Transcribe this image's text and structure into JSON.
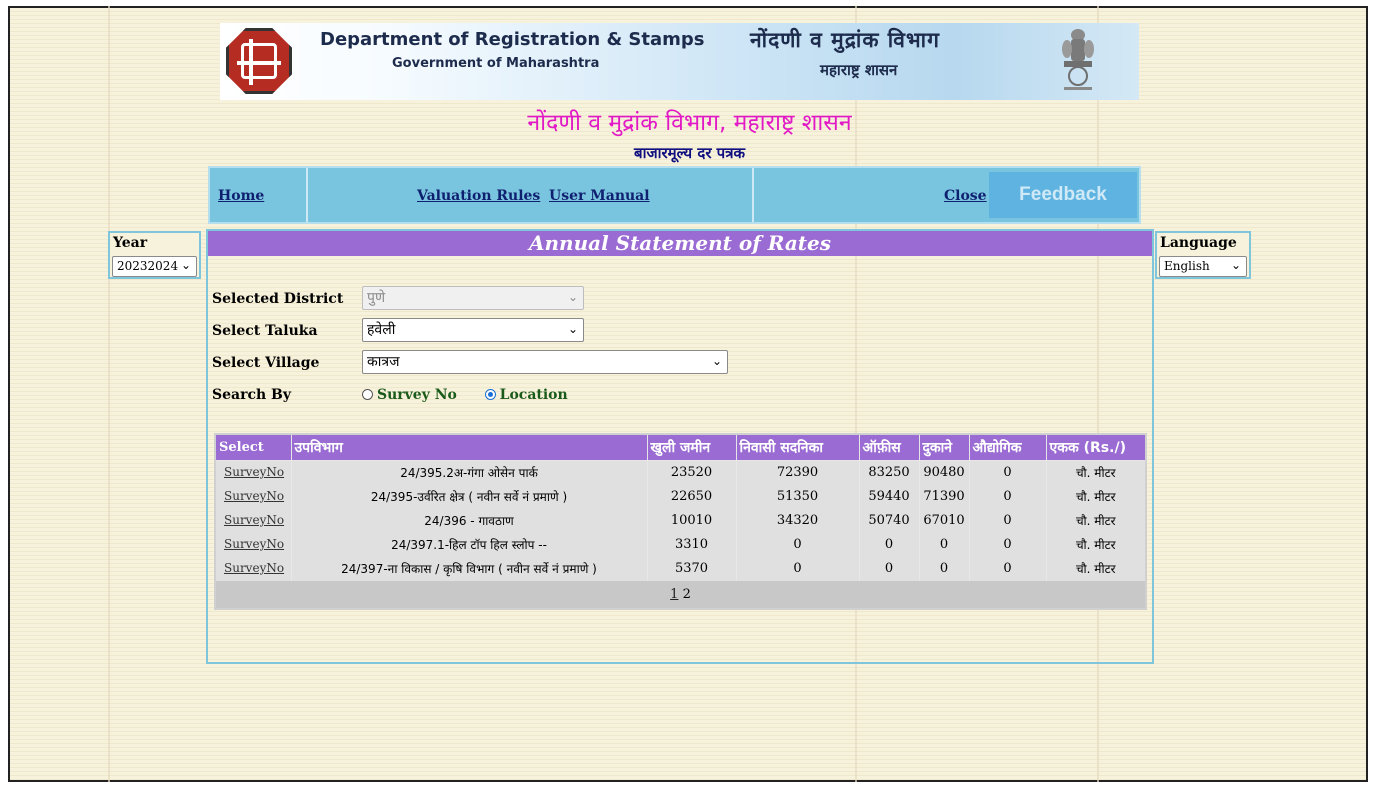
{
  "header": {
    "title_en": "Department of Registration & Stamps",
    "subtitle_en": "Government of Maharashtra",
    "title_mr": "नोंदणी व मुद्रांक विभाग",
    "subtitle_mr": "महाराष्ट्र शासन",
    "main_title": "नोंदणी व मुद्रांक विभाग, महाराष्ट्र शासन",
    "sub_title": "बाजारमूल्य दर पत्रक"
  },
  "nav": {
    "home": "Home",
    "valuation_rules": "Valuation Rules",
    "user_manual": "User Manual",
    "close": "Close",
    "feedback": "Feedback"
  },
  "year": {
    "label": "Year",
    "value": "20232024"
  },
  "language": {
    "label": "Language",
    "value": "English"
  },
  "panel": {
    "title": "Annual Statement of Rates"
  },
  "form": {
    "district_label": "Selected District",
    "district_value": "पुणे",
    "taluka_label": "Select Taluka",
    "taluka_value": "हवेली",
    "village_label": "Select Village",
    "village_value": "कात्रज",
    "search_by_label": "Search By",
    "option_survey": "Survey No",
    "option_location": "Location",
    "selected_option": "Location"
  },
  "table": {
    "headers": [
      "Select",
      "उपविभाग",
      "खुली जमीन",
      "निवासी सदनिका",
      "ऑफ़ीस",
      "दुकाने",
      "औद्योगिक",
      "एकक (Rs./)"
    ],
    "rows": [
      {
        "select": "SurveyNo",
        "subdivision": "24/395.2अ-गंगा ओसेन पार्क",
        "open_land": "23520",
        "residential": "72390",
        "office": "83250",
        "shops": "90480",
        "industrial": "0",
        "unit": "चौ. मीटर"
      },
      {
        "select": "SurveyNo",
        "subdivision": "24/395-उर्वरित क्षेत्र ( नवीन सर्वे नं प्रमाणे )",
        "open_land": "22650",
        "residential": "51350",
        "office": "59440",
        "shops": "71390",
        "industrial": "0",
        "unit": "चौ. मीटर"
      },
      {
        "select": "SurveyNo",
        "subdivision": "24/396 - गावठाण",
        "open_land": "10010",
        "residential": "34320",
        "office": "50740",
        "shops": "67010",
        "industrial": "0",
        "unit": "चौ. मीटर"
      },
      {
        "select": "SurveyNo",
        "subdivision": "24/397.1-हिल टॉप हिल स्लोप --",
        "open_land": "3310",
        "residential": "0",
        "office": "0",
        "shops": "0",
        "industrial": "0",
        "unit": "चौ. मीटर"
      },
      {
        "select": "SurveyNo",
        "subdivision": "24/397-ना विकास / कृषि विभाग ( नवीन सर्वे नं प्रमाणे )",
        "open_land": "5370",
        "residential": "0",
        "office": "0",
        "shops": "0",
        "industrial": "0",
        "unit": "चौ. मीटर"
      }
    ],
    "pager": {
      "current": "1",
      "next": "2"
    }
  },
  "colors": {
    "page_bg": "#f7f2dc",
    "nav_bg": "#79c5df",
    "header_purple": "#9a6bd2",
    "title_magenta": "#e219c6",
    "feedback_bg": "#5eb3e0"
  }
}
